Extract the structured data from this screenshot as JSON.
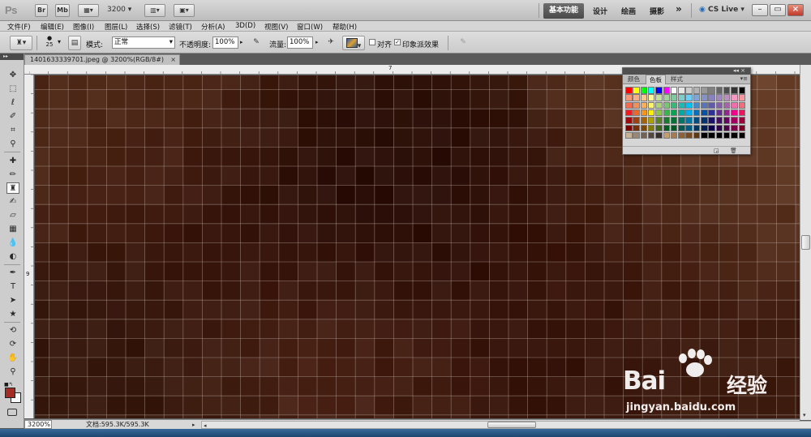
{
  "app": {
    "logo": "Ps",
    "bridge_btn": "Br",
    "minibridge_btn": "Mb",
    "zoom_value": "3200",
    "workspaces": [
      "基本功能",
      "设计",
      "绘画",
      "摄影"
    ],
    "more_ws": "»",
    "cs_live": "CS Live",
    "window_buttons": [
      "–",
      "▭",
      "×"
    ]
  },
  "menu": [
    "文件(F)",
    "编辑(E)",
    "图像(I)",
    "图层(L)",
    "选择(S)",
    "滤镜(T)",
    "分析(A)",
    "3D(D)",
    "视图(V)",
    "窗口(W)",
    "帮助(H)"
  ],
  "options": {
    "brush_size": "25",
    "mode_label": "模式:",
    "mode_value": "正常",
    "opacity_label": "不透明度:",
    "opacity_value": "100%",
    "flow_label": "流量:",
    "flow_value": "100%",
    "aligned_label": "对齐",
    "impression_label": "印象派效果",
    "impression_checked": "✓"
  },
  "document": {
    "tab_title": "1401633339701.jpeg @ 3200%(RGB/8#)",
    "tab_close": "×",
    "ruler_top_mark": "7",
    "ruler_left_mark": "9"
  },
  "status": {
    "zoom": "3200%",
    "doc_info": "文档:595.3K/595.3K",
    "arrow": "▸"
  },
  "swatches": {
    "tabs": [
      "颜色",
      "色板",
      "样式"
    ],
    "active_tab": 1,
    "colors": [
      [
        "#ff0000",
        "#ffff00",
        "#00ff00",
        "#00ffff",
        "#0000ff",
        "#ff00ff",
        "#ffffff",
        "#e6e6e6",
        "#cccccc",
        "#b3b3b3",
        "#999999",
        "#808080",
        "#666666",
        "#4d4d4d",
        "#333333",
        "#000000"
      ],
      [
        "#f7977a",
        "#f9ad81",
        "#fdc68a",
        "#fff79a",
        "#c4df9b",
        "#a3d39c",
        "#82ca9d",
        "#7bcdc8",
        "#6ecff6",
        "#7ea7d8",
        "#8493ca",
        "#8882be",
        "#a187be",
        "#bc8dbf",
        "#f49ac2",
        "#f6989d"
      ],
      [
        "#f26c4f",
        "#f68e55",
        "#fbaf5c",
        "#fff467",
        "#acd372",
        "#7cc576",
        "#3bb878",
        "#1abbb4",
        "#00bff3",
        "#438ccb",
        "#5574b9",
        "#605ca8",
        "#855fa8",
        "#a763a8",
        "#f06ea9",
        "#f26d7d"
      ],
      [
        "#ed1c24",
        "#f26522",
        "#f7941d",
        "#fff200",
        "#8dc63f",
        "#39b54a",
        "#00a651",
        "#00a99d",
        "#00aeef",
        "#0072bc",
        "#0054a6",
        "#2e3192",
        "#662d91",
        "#92278f",
        "#ec008c",
        "#ed145b"
      ],
      [
        "#9e0b0f",
        "#a0410d",
        "#a36209",
        "#aba000",
        "#598527",
        "#1a7b30",
        "#007236",
        "#00746b",
        "#0076a3",
        "#004b80",
        "#003471",
        "#1b1464",
        "#440e62",
        "#630460",
        "#9e005d",
        "#9e0039"
      ],
      [
        "#790000",
        "#7b2e00",
        "#7d4900",
        "#827b00",
        "#406618",
        "#005e20",
        "#005826",
        "#005952",
        "#005b7f",
        "#003663",
        "#002157",
        "#0d004c",
        "#32004b",
        "#4b0049",
        "#7b0046",
        "#7a0026"
      ],
      [
        "#c7b299",
        "#998675",
        "#736357",
        "#534741",
        "#37302d",
        "#c69c6e",
        "#a67c52",
        "#8c6239",
        "#754c24",
        "#603913",
        "#000000",
        "#000000",
        "#000000",
        "#000000",
        "#000000",
        "#000000"
      ]
    ]
  },
  "watermark": {
    "brand": "Bai",
    "brand_suffix": "经验",
    "url": "jingyan.baidu.com"
  }
}
